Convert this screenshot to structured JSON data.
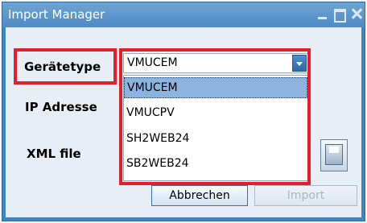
{
  "window": {
    "title": "Import Manager"
  },
  "form": {
    "type_label": "Gerätetype",
    "ip_label": "IP Adresse",
    "xml_label": "XML file"
  },
  "combo": {
    "selected_value": "VMUCEM",
    "options": [
      "VMUCEM",
      "VMUCPV",
      "SH2WEB24",
      "SB2WEB24"
    ],
    "highlighted_index": 0
  },
  "buttons": {
    "cancel_label": "Abbrechen",
    "import_label": "Import",
    "import_enabled": false
  },
  "colors": {
    "highlight_border": "#e41e2b",
    "title_bar": "#4d8bc4",
    "selected_option": "#8db3df"
  }
}
